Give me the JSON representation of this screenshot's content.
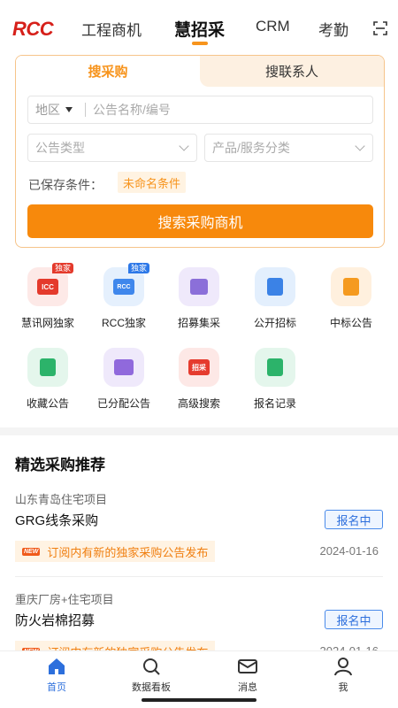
{
  "header": {
    "logo": "RCC",
    "tabs": [
      {
        "label": "工程商机"
      },
      {
        "label": "慧招采"
      },
      {
        "label": "CRM"
      },
      {
        "label": "考勤"
      }
    ]
  },
  "search": {
    "tab_procurement": "搜采购",
    "tab_contacts": "搜联系人",
    "region": "地区",
    "keyword_placeholder": "公告名称/编号",
    "type_placeholder": "公告类型",
    "category_placeholder": "产品/服务分类",
    "saved_label": "已保存条件：",
    "saved_chip": "未命名条件",
    "button": "搜索采购商机"
  },
  "grid": {
    "items": [
      {
        "label": "慧讯网独家",
        "icon": "icc-exclusive-icon",
        "badge": "独家"
      },
      {
        "label": "RCC独家",
        "icon": "rcc-exclusive-icon",
        "badge": "独家"
      },
      {
        "label": "招募集采",
        "icon": "recruit-procurement-icon"
      },
      {
        "label": "公开招标",
        "icon": "public-tender-icon"
      },
      {
        "label": "中标公告",
        "icon": "award-notice-icon"
      },
      {
        "label": "收藏公告",
        "icon": "favorite-notice-icon"
      },
      {
        "label": "已分配公告",
        "icon": "assigned-notice-icon"
      },
      {
        "label": "高级搜索",
        "icon": "advanced-search-icon",
        "icon_text": "招采"
      },
      {
        "label": "报名记录",
        "icon": "registration-record-icon"
      }
    ]
  },
  "recommend": {
    "title": "精选采购推荐",
    "items": [
      {
        "region": "山东青岛住宅项目",
        "name": "GRG线条采购",
        "status": "报名中",
        "tag": "NEW",
        "notice": "订阅内有新的独家采购公告发布",
        "date": "2024-01-16"
      },
      {
        "region": "重庆厂房+住宅项目",
        "name": "防火岩棉招募",
        "status": "报名中",
        "tag": "NEW",
        "notice": "订阅内有新的独家采购公告发布",
        "date": "2024-01-16"
      }
    ]
  },
  "bottom_nav": {
    "items": [
      {
        "label": "首页"
      },
      {
        "label": "数据看板"
      },
      {
        "label": "消息"
      },
      {
        "label": "我"
      }
    ]
  },
  "colors": {
    "accent": "#f7941d",
    "brand_red": "#d6201a",
    "blue": "#2d6fdc"
  }
}
